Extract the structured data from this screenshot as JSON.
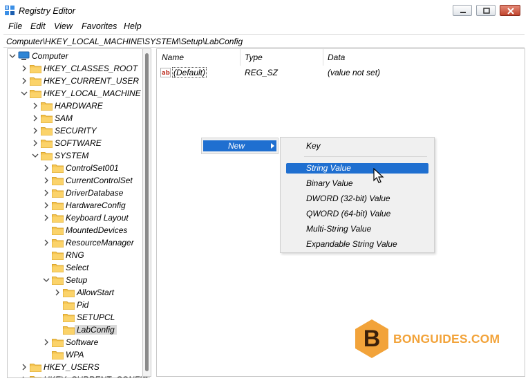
{
  "window": {
    "title": "Registry Editor"
  },
  "menu": [
    "File",
    "Edit",
    "View",
    "Favorites",
    "Help"
  ],
  "address": "Computer\\HKEY_LOCAL_MACHINE\\SYSTEM\\Setup\\LabConfig",
  "tree": [
    {
      "label": "Computer",
      "kind": "computer",
      "level": 0,
      "chev": "down"
    },
    {
      "label": "HKEY_CLASSES_ROOT",
      "level": 1,
      "chev": "right"
    },
    {
      "label": "HKEY_CURRENT_USER",
      "level": 1,
      "chev": "right"
    },
    {
      "label": "HKEY_LOCAL_MACHINE",
      "level": 1,
      "chev": "down"
    },
    {
      "label": "HARDWARE",
      "level": 2,
      "chev": "right"
    },
    {
      "label": "SAM",
      "level": 2,
      "chev": "right"
    },
    {
      "label": "SECURITY",
      "level": 2,
      "chev": "right"
    },
    {
      "label": "SOFTWARE",
      "level": 2,
      "chev": "right"
    },
    {
      "label": "SYSTEM",
      "level": 2,
      "chev": "down"
    },
    {
      "label": "ControlSet001",
      "level": 3,
      "chev": "right"
    },
    {
      "label": "CurrentControlSet",
      "level": 3,
      "chev": "right"
    },
    {
      "label": "DriverDatabase",
      "level": 3,
      "chev": "right"
    },
    {
      "label": "HardwareConfig",
      "level": 3,
      "chev": "right"
    },
    {
      "label": "Keyboard Layout",
      "level": 3,
      "chev": "right"
    },
    {
      "label": "MountedDevices",
      "level": 3,
      "chev": "none"
    },
    {
      "label": "ResourceManager",
      "level": 3,
      "chev": "right"
    },
    {
      "label": "RNG",
      "level": 3,
      "chev": "none"
    },
    {
      "label": "Select",
      "level": 3,
      "chev": "none"
    },
    {
      "label": "Setup",
      "level": 3,
      "chev": "down"
    },
    {
      "label": "AllowStart",
      "level": 4,
      "chev": "right"
    },
    {
      "label": "Pid",
      "level": 4,
      "chev": "none"
    },
    {
      "label": "SETUPCL",
      "level": 4,
      "chev": "none"
    },
    {
      "label": "LabConfig",
      "level": 4,
      "chev": "none",
      "selected": true
    },
    {
      "label": "Software",
      "level": 3,
      "chev": "right"
    },
    {
      "label": "WPA",
      "level": 3,
      "chev": "none"
    },
    {
      "label": "HKEY_USERS",
      "level": 1,
      "chev": "right"
    },
    {
      "label": "HKEY_CURRENT_CONFIG",
      "level": 1,
      "chev": "right"
    }
  ],
  "columns": {
    "name": "Name",
    "type": "Type",
    "data": "Data"
  },
  "values": [
    {
      "name": "(Default)",
      "type": "REG_SZ",
      "data": "(value not set)",
      "icon": "ab-string-icon"
    }
  ],
  "context_menu": {
    "new_label": "New"
  },
  "submenu": {
    "items": [
      "Key",
      "String Value",
      "Binary Value",
      "DWORD (32-bit) Value",
      "QWORD (64-bit) Value",
      "Multi-String Value",
      "Expandable String Value"
    ],
    "highlighted": 1
  },
  "watermark": {
    "text": "BONGUIDES.COM",
    "letter": "B"
  },
  "colors": {
    "highlight": "#1f6fd0",
    "folder": "#f5c451",
    "watermark": "#f2a33a"
  }
}
